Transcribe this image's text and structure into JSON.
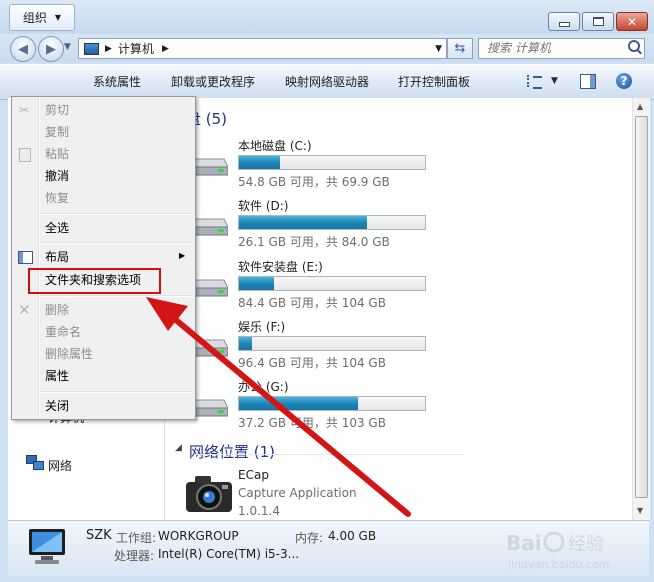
{
  "address": {
    "path": "计算机"
  },
  "search": {
    "placeholder": "搜索 计算机"
  },
  "toolbar": {
    "organize": "组织",
    "system_properties": "系统属性",
    "uninstall": "卸载或更改程序",
    "map_drive": "映射网络驱动器",
    "control_panel": "打开控制面板"
  },
  "menu": {
    "cut": "剪切",
    "copy": "复制",
    "paste": "粘贴",
    "undo": "撤消",
    "redo": "恢复",
    "select_all": "全选",
    "layout": "布局",
    "folder_options": "文件夹和搜索选项",
    "delete": "删除",
    "rename": "重命名",
    "remove_properties": "删除属性",
    "properties": "属性",
    "close": "关闭"
  },
  "sections": {
    "hard_drives_partial": "硬盘 (5)",
    "network_location": "网络位置 (1)"
  },
  "drives": [
    {
      "name": "本地磁盘 (C:)",
      "info": "54.8 GB 可用，共 69.9 GB",
      "used_fraction": 0.22
    },
    {
      "name": "软件 (D:)",
      "info": "26.1 GB 可用，共 84.0 GB",
      "used_fraction": 0.69
    },
    {
      "name": "软件安装盘 (E:)",
      "info": "84.4 GB 可用，共 104 GB",
      "used_fraction": 0.19
    },
    {
      "name": "娱乐 (F:)",
      "info": "96.4 GB 可用，共 104 GB",
      "used_fraction": 0.07
    },
    {
      "name": "办公 (G:)",
      "info": "37.2 GB 可用，共 103 GB",
      "used_fraction": 0.64
    }
  ],
  "network_item": {
    "name": "ECap",
    "description": "Capture Application",
    "version": "1.0.1.4"
  },
  "navpane": {
    "computer_partial": "计算机",
    "network": "网络"
  },
  "status": {
    "computer_name": "SZK",
    "workgroup_label": "工作组:",
    "workgroup": "WORKGROUP",
    "memory_label": "内存:",
    "memory": "4.00 GB",
    "processor_label": "处理器:",
    "processor": "Intel(R) Core(TM) i5-3..."
  },
  "watermark": "Baidu 经验 jingyan.baidu.com",
  "colors": {
    "drive_bar": "#1c82b6",
    "highlight_box": "#d00f0f",
    "arrow": "#d41515"
  }
}
